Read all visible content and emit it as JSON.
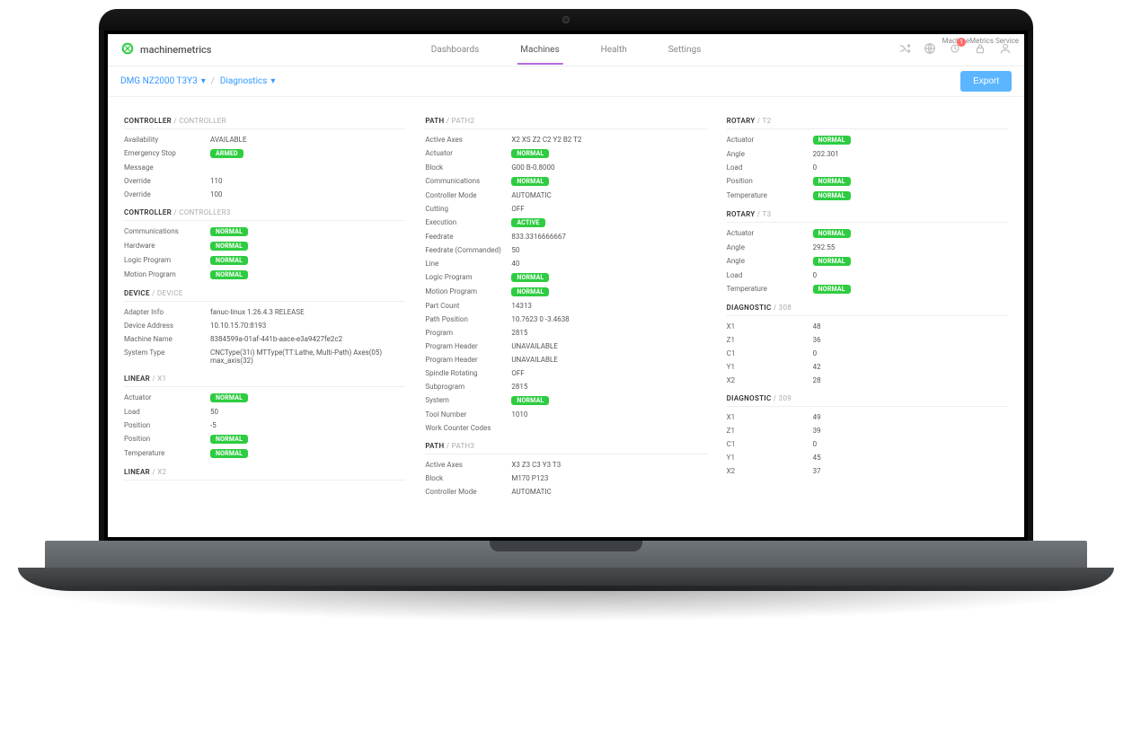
{
  "service_label": "MachineMetrics Service",
  "brand": "machinemetrics",
  "nav": {
    "dashboards": "Dashboards",
    "machines": "Machines",
    "health": "Health",
    "settings": "Settings"
  },
  "notif_count": "1",
  "breadcrumb": {
    "machine": "DMG NZ2000 T3Y3",
    "page": "Diagnostics"
  },
  "export_label": "Export",
  "badges": {
    "normal": "NORMAL",
    "armed": "ARMED",
    "active": "ACTIVE"
  },
  "col1": {
    "s1": {
      "title": "CONTROLLER",
      "sub": " / CONTROLLER",
      "availability_l": "Availability",
      "availability_v": "AVAILABLE",
      "estop_l": "Emergency Stop",
      "message_l": "Message",
      "message_v": "",
      "override1_l": "Override",
      "override1_v": "110",
      "override2_l": "Override",
      "override2_v": "100"
    },
    "s2": {
      "title": "CONTROLLER",
      "sub": " / CONTROLLER3",
      "comm_l": "Communications",
      "hw_l": "Hardware",
      "logic_l": "Logic Program",
      "motion_l": "Motion Program"
    },
    "s3": {
      "title": "DEVICE",
      "sub": " / DEVICE",
      "adapter_l": "Adapter Info",
      "adapter_v": "fanuc-linux 1.26.4.3 RELEASE",
      "addr_l": "Device Address",
      "addr_v": "10.10.15.70:8193",
      "name_l": "Machine Name",
      "name_v": "8384599a-01af-441b-aace-e3a9427fe2c2",
      "sys_l": "System Type",
      "sys_v": "CNCType(31i) MTType(TT:Lathe, Multi-Path) Axes(05) max_axis(32)"
    },
    "s4": {
      "title": "LINEAR",
      "sub": " / X1",
      "act_l": "Actuator",
      "load_l": "Load",
      "load_v": "50",
      "pos1_l": "Position",
      "pos1_v": "-5",
      "pos2_l": "Position",
      "temp_l": "Temperature"
    },
    "s5": {
      "title": "LINEAR",
      "sub": " / X2"
    }
  },
  "col2": {
    "p2": {
      "title": "PATH",
      "sub": " / PATH2",
      "axes_l": "Active Axes",
      "axes_v": "X2 XS Z2 C2 Y2 B2 T2",
      "act_l": "Actuator",
      "block_l": "Block",
      "block_v": "G00 B-0.8000",
      "comm_l": "Communications",
      "mode_l": "Controller Mode",
      "mode_v": "AUTOMATIC",
      "cut_l": "Cutting",
      "cut_v": "OFF",
      "exec_l": "Execution",
      "feed_l": "Feedrate",
      "feed_v": "833.3316666667",
      "feedc_l": "Feedrate (Commanded)",
      "feedc_v": "50",
      "line_l": "Line",
      "line_v": "40",
      "logic_l": "Logic Program",
      "motion_l": "Motion Program",
      "pc_l": "Part Count",
      "pc_v": "14313",
      "pp_l": "Path Position",
      "pp_v": "10.7623 0 -3.4638",
      "prog_l": "Program",
      "prog_v": "2815",
      "ph1_l": "Program Header",
      "ph1_v": "UNAVAILABLE",
      "ph2_l": "Program Header",
      "ph2_v": "UNAVAILABLE",
      "spin_l": "Spindle Rotating",
      "spin_v": "OFF",
      "sub_l": "Subprogram",
      "sub_v": "2815",
      "sys_l": "System",
      "tool_l": "Tool Number",
      "tool_v": "1010",
      "wcc_l": "Work Counter Codes",
      "wcc_v": ""
    },
    "p3": {
      "title": "PATH",
      "sub": " / PATH3",
      "axes_l": "Active Axes",
      "axes_v": "X3 Z3 C3 Y3 T3",
      "block_l": "Block",
      "block_v": "M170 P123",
      "mode_l": "Controller Mode",
      "mode_v": "AUTOMATIC"
    }
  },
  "col3": {
    "r2": {
      "title": "ROTARY",
      "sub": " / T2",
      "act_l": "Actuator",
      "ang_l": "Angle",
      "ang_v": "202.301",
      "load_l": "Load",
      "load_v": "0",
      "pos_l": "Position",
      "temp_l": "Temperature"
    },
    "r3": {
      "title": "ROTARY",
      "sub": " / T3",
      "act_l": "Actuator",
      "ang1_l": "Angle",
      "ang1_v": "292.55",
      "ang2_l": "Angle",
      "load_l": "Load",
      "load_v": "0",
      "temp_l": "Temperature"
    },
    "d308": {
      "title": "DIAGNOSTIC",
      "sub": " / 308",
      "x1_l": "X1",
      "x1_v": "48",
      "z1_l": "Z1",
      "z1_v": "36",
      "c1_l": "C1",
      "c1_v": "0",
      "y1_l": "Y1",
      "y1_v": "42",
      "x2_l": "X2",
      "x2_v": "28"
    },
    "d309": {
      "title": "DIAGNOSTIC",
      "sub": " / 309",
      "x1_l": "X1",
      "x1_v": "49",
      "z1_l": "Z1",
      "z1_v": "39",
      "c1_l": "C1",
      "c1_v": "0",
      "y1_l": "Y1",
      "y1_v": "45",
      "x2_l": "X2",
      "x2_v": "37"
    }
  }
}
